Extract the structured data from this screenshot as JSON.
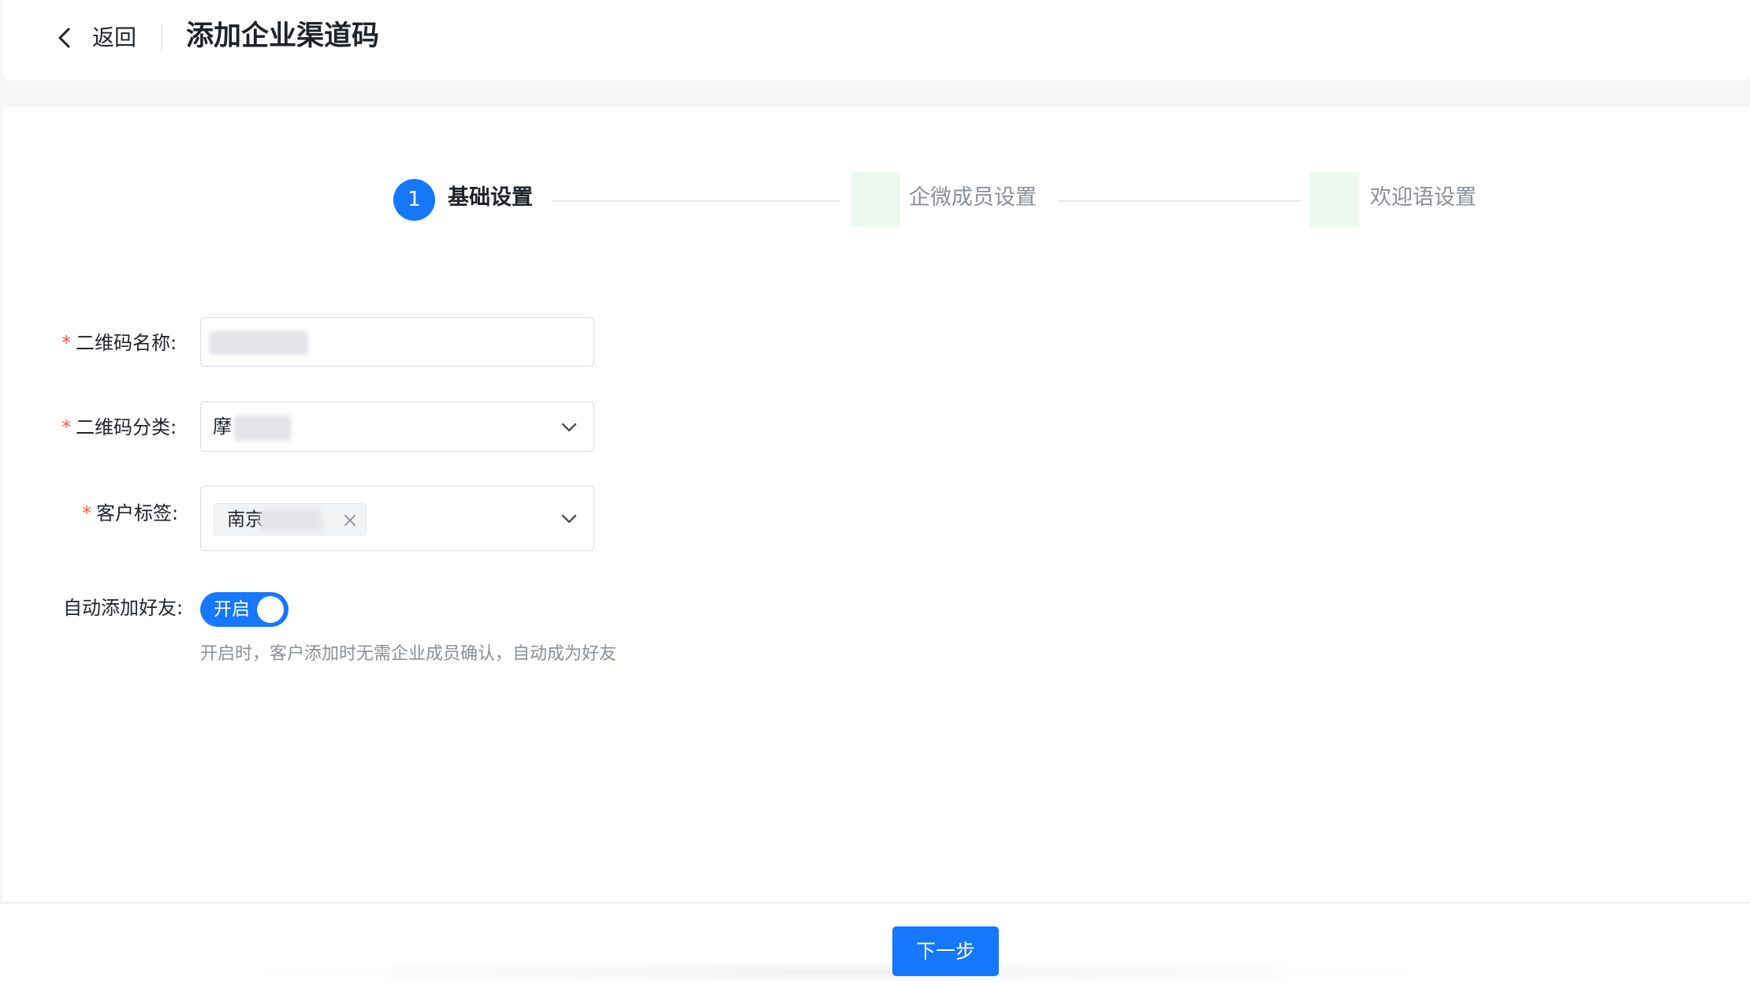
{
  "header": {
    "back_label": "返回",
    "title": "添加企业渠道码"
  },
  "steps": [
    {
      "index": "1",
      "label": "基础设置",
      "active": true
    },
    {
      "label": "企微成员设置",
      "active": false
    },
    {
      "label": "欢迎语设置",
      "active": false
    }
  ],
  "form": {
    "required_mark": "*",
    "qr_name": {
      "label": "二维码名称:",
      "value": ""
    },
    "qr_category": {
      "label": "二维码分类:",
      "value": "摩"
    },
    "customer_tags": {
      "label": "客户标签:",
      "tags": [
        {
          "text": "南京"
        }
      ]
    },
    "auto_add_friend": {
      "label": "自动添加好友:",
      "switch_text": "开启",
      "enabled": true,
      "hint": "开启时，客户添加时无需企业成员确认，自动成为好友"
    }
  },
  "footer": {
    "next_label": "下一步"
  },
  "colors": {
    "primary": "#1677ff",
    "required": "#f5613e",
    "muted_text": "#8a8f99"
  }
}
